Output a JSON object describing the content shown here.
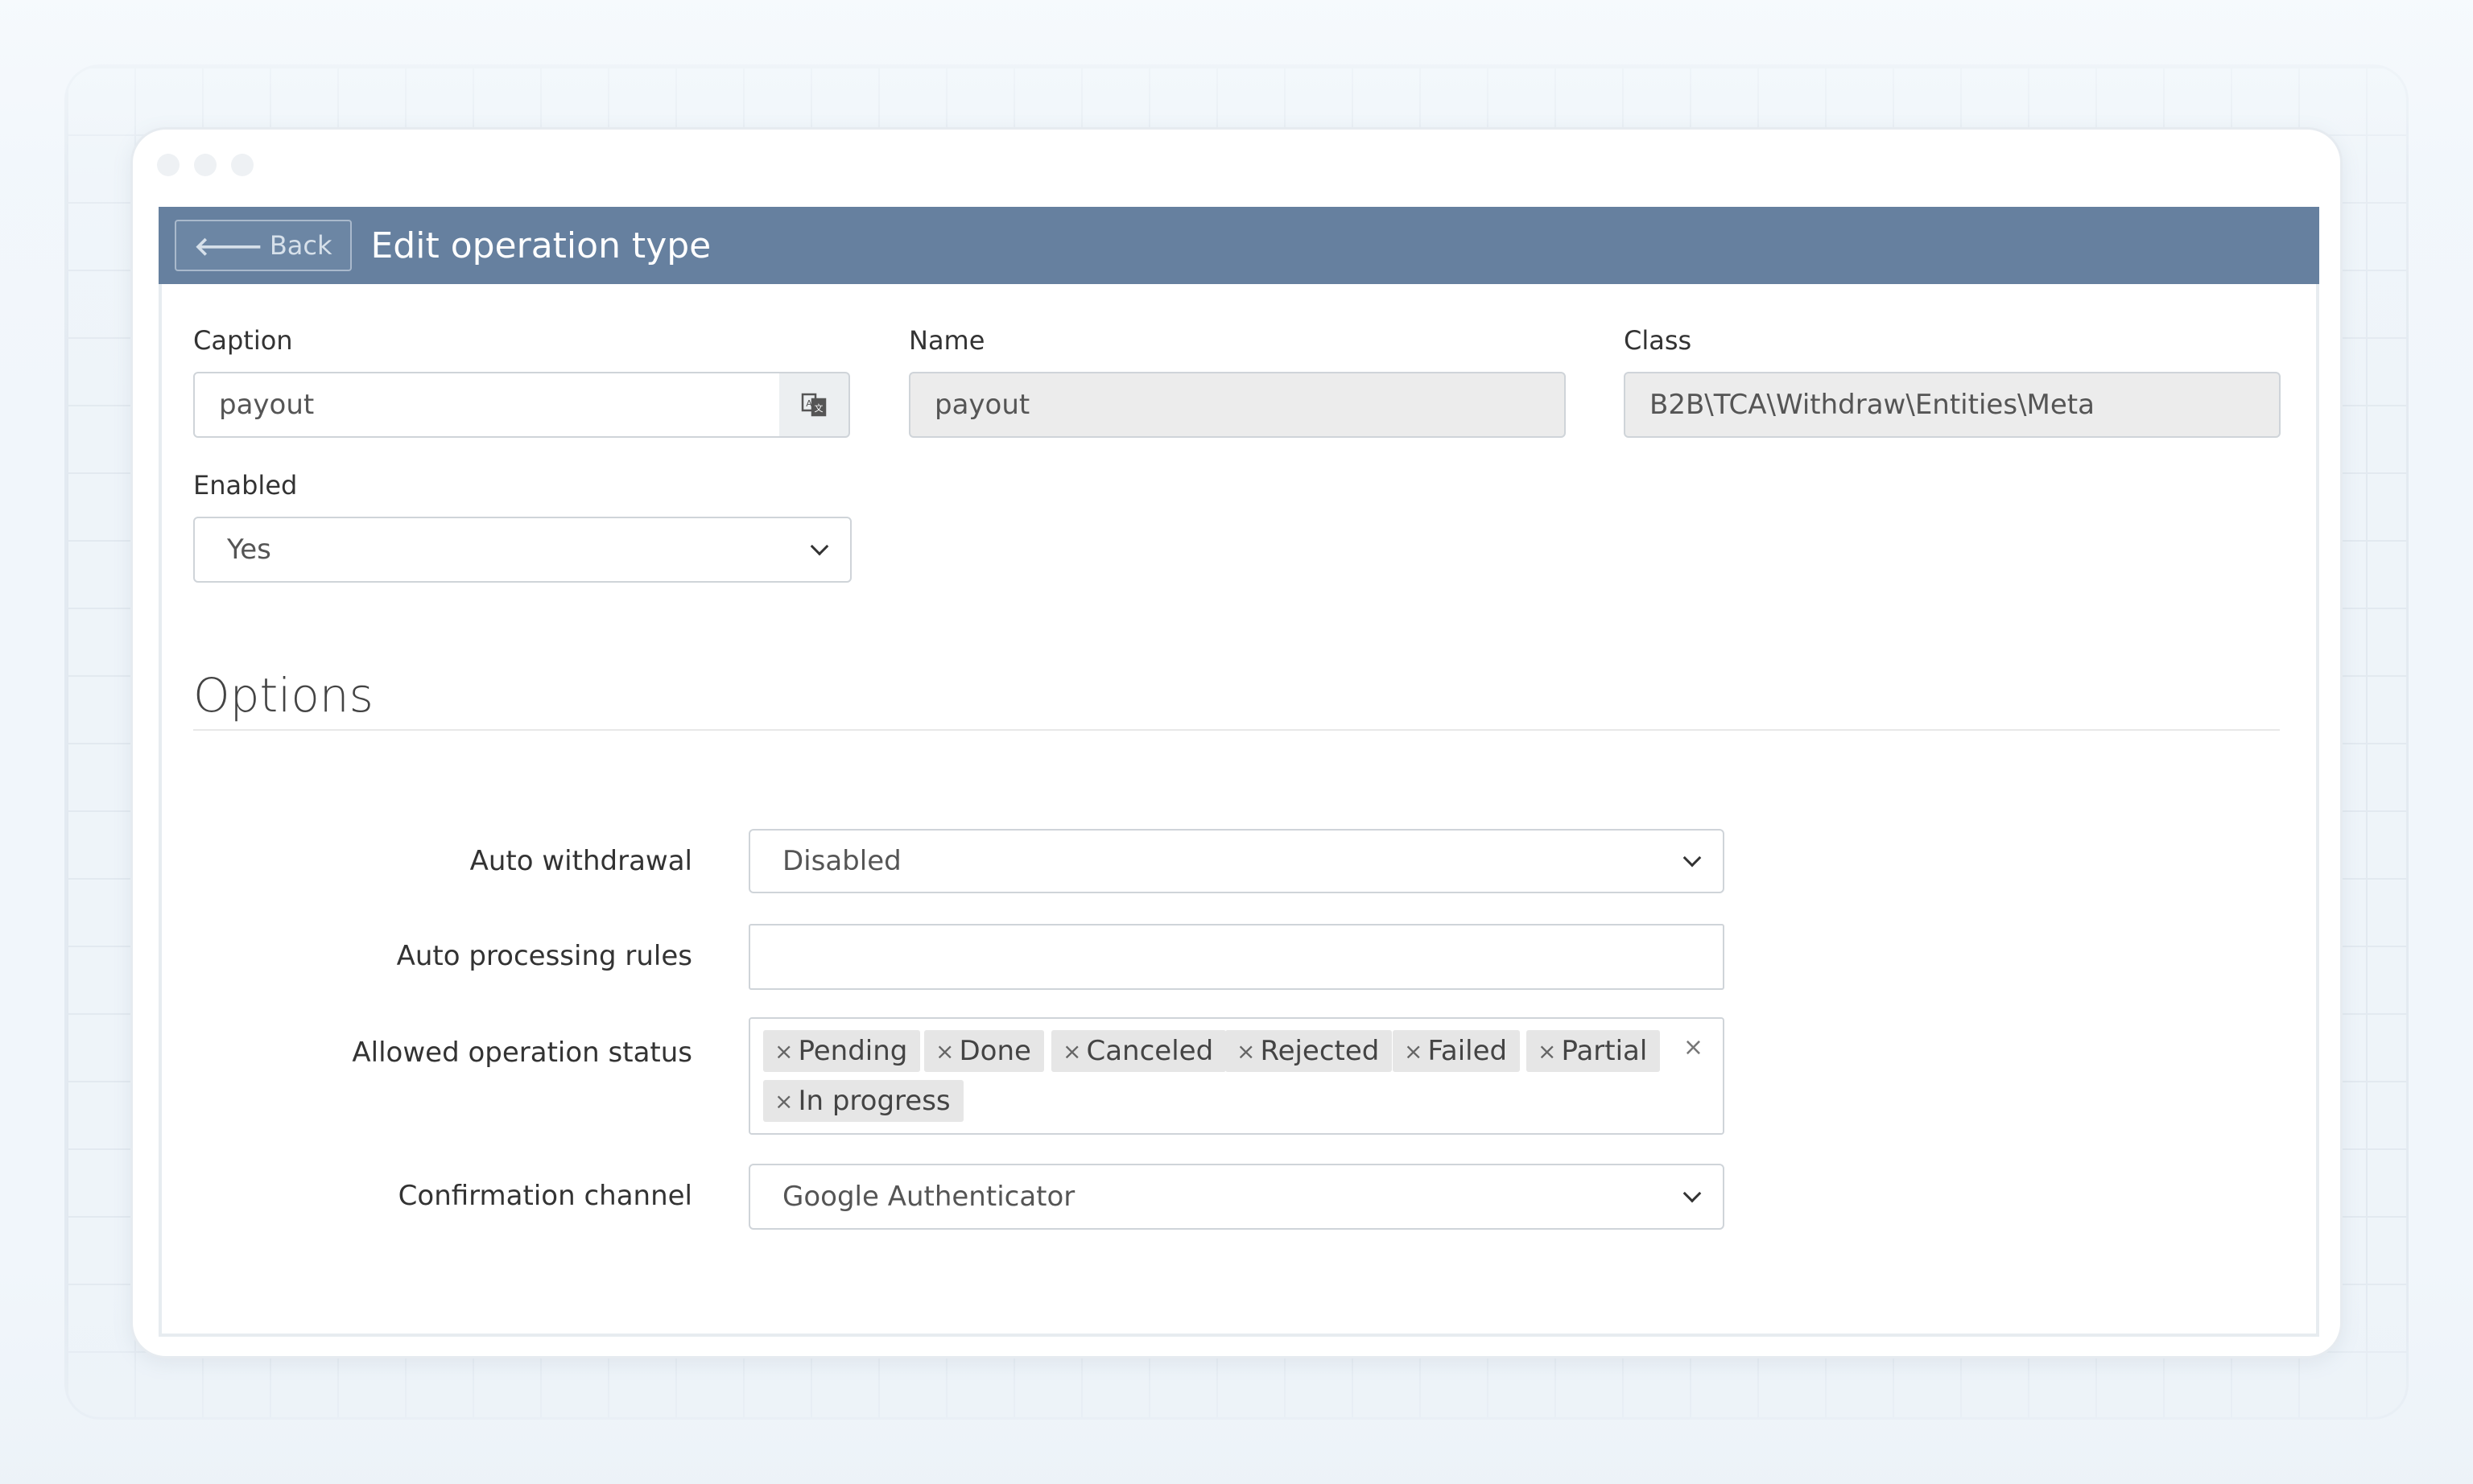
{
  "header": {
    "back_label": "Back",
    "title": "Edit operation type"
  },
  "form": {
    "caption": {
      "label": "Caption",
      "value": "payout",
      "addon_icon": "translate-icon"
    },
    "name": {
      "label": "Name",
      "value": "payout"
    },
    "class": {
      "label": "Class",
      "value": "B2B\\TCA\\Withdraw\\Entities\\Meta"
    },
    "enabled": {
      "label": "Enabled",
      "value": "Yes"
    }
  },
  "options": {
    "title": "Options",
    "auto_withdrawal": {
      "label": "Auto withdrawal",
      "value": "Disabled"
    },
    "auto_processing_rules": {
      "label": "Auto processing rules",
      "value": ""
    },
    "allowed_status": {
      "label": "Allowed operation status",
      "tags": [
        "Pending",
        "Done",
        "Canceled",
        "Rejected",
        "Failed",
        "Partial",
        "In progress"
      ],
      "remove_glyph": "×",
      "clear_glyph": "×"
    },
    "confirmation_channel": {
      "label": "Confirmation channel",
      "value": "Google Authenticator"
    }
  },
  "colors": {
    "header_bg": "#66809f",
    "page_bg": "#f1f6fb",
    "disabled_bg": "#ececec"
  }
}
